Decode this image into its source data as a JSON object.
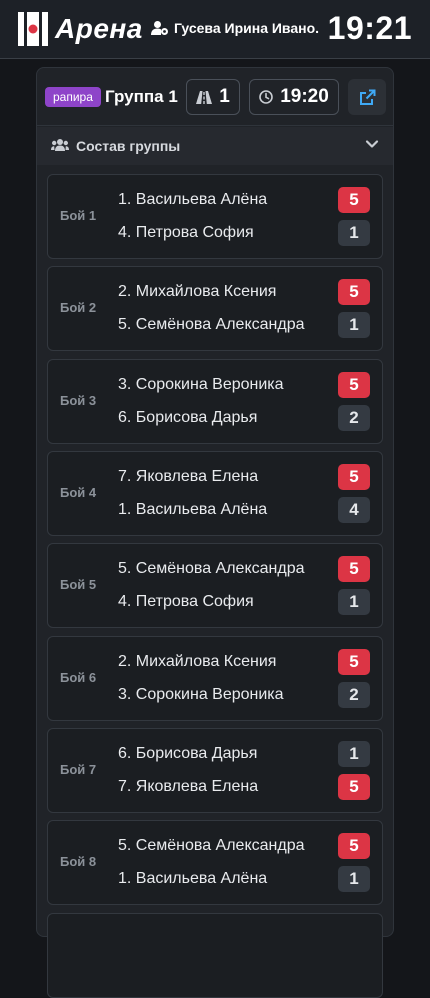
{
  "header": {
    "app_name": "Арена",
    "user_name": "Гусева Ирина Ивано...",
    "time": "19:21"
  },
  "group": {
    "weapon": "рапира",
    "title": "Группа 1",
    "piste": "1",
    "start_time": "19:20",
    "roster_label": "Состав группы"
  },
  "bouts": [
    {
      "label": "Бой 1",
      "a": "1. Васильева Алёна",
      "b": "4. Петрова София",
      "score_a": "5",
      "score_b": "1"
    },
    {
      "label": "Бой 2",
      "a": "2. Михайлова Ксения",
      "b": "5. Семёнова Александра",
      "score_a": "5",
      "score_b": "1"
    },
    {
      "label": "Бой 3",
      "a": "3. Сорокина Вероника",
      "b": "6. Борисова Дарья",
      "score_a": "5",
      "score_b": "2"
    },
    {
      "label": "Бой 4",
      "a": "7. Яковлева Елена",
      "b": "1. Васильева Алёна",
      "score_a": "5",
      "score_b": "4"
    },
    {
      "label": "Бой 5",
      "a": "5. Семёнова Александра",
      "b": "4. Петрова София",
      "score_a": "5",
      "score_b": "1"
    },
    {
      "label": "Бой 6",
      "a": "2. Михайлова Ксения",
      "b": "3. Сорокина Вероника",
      "score_a": "5",
      "score_b": "2"
    },
    {
      "label": "Бой 7",
      "a": "6. Борисова Дарья",
      "b": "7. Яковлева Елена",
      "score_a": "1",
      "score_b": "5"
    },
    {
      "label": "Бой 8",
      "a": "5. Семёнова Александра",
      "b": "1. Васильева Алёна",
      "score_a": "5",
      "score_b": "1"
    }
  ],
  "colors": {
    "win": "#dc3545",
    "lose": "#343a42",
    "weapon_badge": "#8e44c9",
    "link_icon": "#3fa9f5"
  },
  "icons": {
    "logo": "arena-logo-icon",
    "user": "user-gear-icon",
    "piste": "road-icon",
    "time": "clock-icon",
    "external": "external-link-icon",
    "roster": "users-icon",
    "expand": "chevron-down-icon"
  }
}
